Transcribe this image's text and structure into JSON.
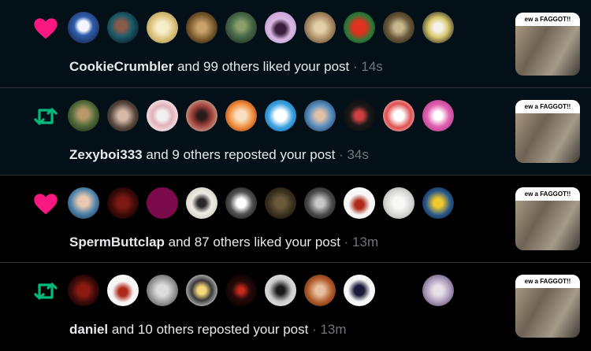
{
  "notifications": [
    {
      "type_icon": "heart-icon",
      "name": "CookieCrumbler",
      "action_text": " and 99 others liked your post",
      "time_text": " · 14s",
      "thumb_caption": "ew a FAGGOT!!"
    },
    {
      "type_icon": "repost-icon",
      "name": "Zexyboi333",
      "action_text": " and 9 others reposted your post",
      "time_text": " · 34s",
      "thumb_caption": "ew a FAGGOT!!"
    },
    {
      "type_icon": "heart-icon",
      "name": "SpermButtclap",
      "action_text": " and 87 others liked your post",
      "time_text": " · 13m",
      "thumb_caption": "ew a FAGGOT!!"
    },
    {
      "type_icon": "repost-icon",
      "name": "daniel",
      "action_text": " and 10 others reposted your post",
      "time_text": " · 13m",
      "thumb_caption": "ew a FAGGOT!!"
    }
  ],
  "colors": {
    "like": "#f91880",
    "repost": "#00ba7c",
    "text": "#e7e9ea",
    "muted": "#71767b",
    "divider": "#2e3338",
    "row_bg_dark": "#000000",
    "row_bg_tint": "#031018"
  }
}
